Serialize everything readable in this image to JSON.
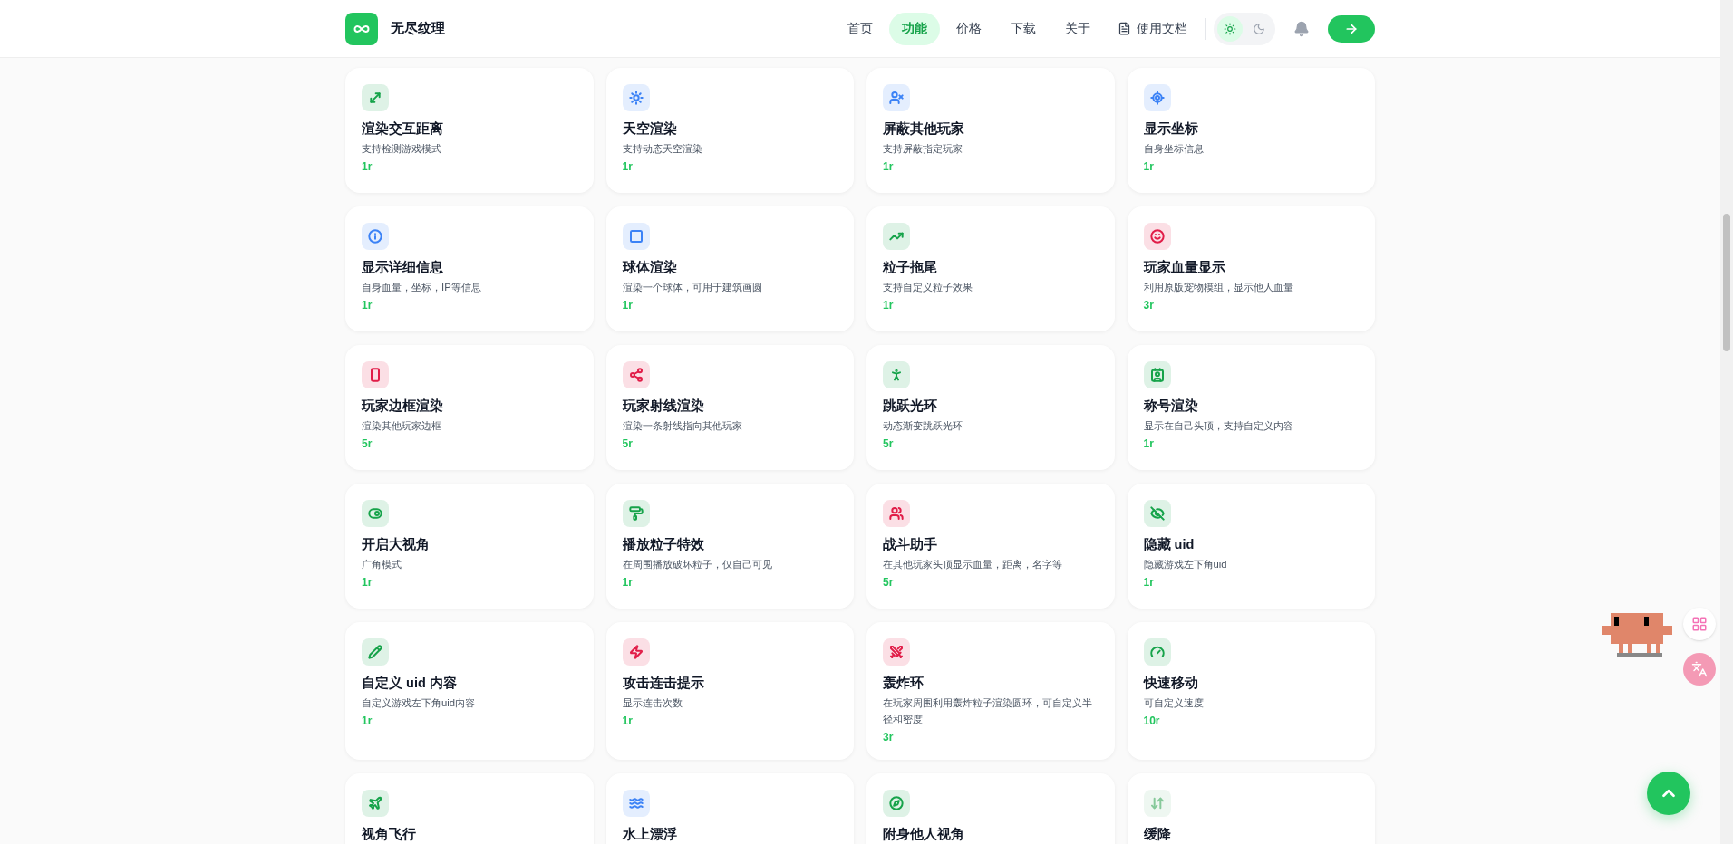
{
  "brand": {
    "name": "无尽纹理"
  },
  "nav": [
    {
      "kind": "link",
      "label": "首页",
      "selected": false
    },
    {
      "kind": "link",
      "label": "功能",
      "selected": true
    },
    {
      "kind": "link",
      "label": "价格",
      "selected": false
    },
    {
      "kind": "link",
      "label": "下载",
      "selected": false
    },
    {
      "kind": "link",
      "label": "关于",
      "selected": false
    },
    {
      "kind": "doc",
      "label": "使用文档",
      "selected": false
    }
  ],
  "theme": [
    {
      "kind": "light",
      "selected": true
    },
    {
      "kind": "dark",
      "selected": false
    }
  ],
  "features": [
    {
      "title": "渲染交互距离",
      "desc": "支持检测游戏模式",
      "price": "1r",
      "color": "#16a34a"
    },
    {
      "title": "天空渲染",
      "desc": "支持动态天空渲染",
      "price": "1r",
      "color": "#3b82f6"
    },
    {
      "title": "屏蔽其他玩家",
      "desc": "支持屏蔽指定玩家",
      "price": "1r",
      "color": "#3b82f6"
    },
    {
      "title": "显示坐标",
      "desc": "自身坐标信息",
      "price": "1r",
      "color": "#3b82f6"
    },
    {
      "title": "显示详细信息",
      "desc": "自身血量，坐标，IP等信息",
      "price": "1r",
      "color": "#3b82f6"
    },
    {
      "title": "球体渲染",
      "desc": "渲染一个球体，可用于建筑画圆",
      "price": "1r",
      "color": "#3b82f6"
    },
    {
      "title": "粒子拖尾",
      "desc": "支持自定义粒子效果",
      "price": "1r",
      "color": "#16a34a"
    },
    {
      "title": "玩家血量显示",
      "desc": "利用原版宠物模组，显示他人血量",
      "price": "3r",
      "color": "#e11d48"
    },
    {
      "title": "玩家边框渲染",
      "desc": "渲染其他玩家边框",
      "price": "5r",
      "color": "#e11d48"
    },
    {
      "title": "玩家射线渲染",
      "desc": "渲染一条射线指向其他玩家",
      "price": "5r",
      "color": "#e11d48"
    },
    {
      "title": "跳跃光环",
      "desc": "动态渐变跳跃光环",
      "price": "5r",
      "color": "#16a34a"
    },
    {
      "title": "称号渲染",
      "desc": "显示在自己头顶，支持自定义内容",
      "price": "1r",
      "color": "#16a34a"
    },
    {
      "title": "开启大视角",
      "desc": "广角模式",
      "price": "1r",
      "color": "#16a34a"
    },
    {
      "title": "播放粒子特效",
      "desc": "在周围播放破坏粒子，仅自己可见",
      "price": "1r",
      "color": "#16a34a"
    },
    {
      "title": "战斗助手",
      "desc": "在其他玩家头顶显示血量，距离，名字等",
      "price": "5r",
      "color": "#e11d48"
    },
    {
      "title": "隐藏 uid",
      "desc": "隐藏游戏左下角uid",
      "price": "1r",
      "color": "#16a34a"
    },
    {
      "title": "自定义 uid 内容",
      "desc": "自定义游戏左下角uid内容",
      "price": "1r",
      "color": "#16a34a"
    },
    {
      "title": "攻击连击提示",
      "desc": "显示连击次数",
      "price": "1r",
      "color": "#e11d48"
    },
    {
      "title": "轰炸环",
      "desc": "在玩家周围利用轰炸粒子渲染圆环，可自定义半径和密度",
      "price": "3r",
      "color": "#e11d48"
    },
    {
      "title": "快速移动",
      "desc": "可自定义速度",
      "price": "10r",
      "color": "#16a34a"
    },
    {
      "title": "视角飞行",
      "color": "#16a34a"
    },
    {
      "title": "水上漂浮",
      "color": "#3b82f6"
    },
    {
      "title": "附身他人视角",
      "color": "#16a34a"
    },
    {
      "title": "缓降",
      "color": "#86c99a"
    }
  ]
}
